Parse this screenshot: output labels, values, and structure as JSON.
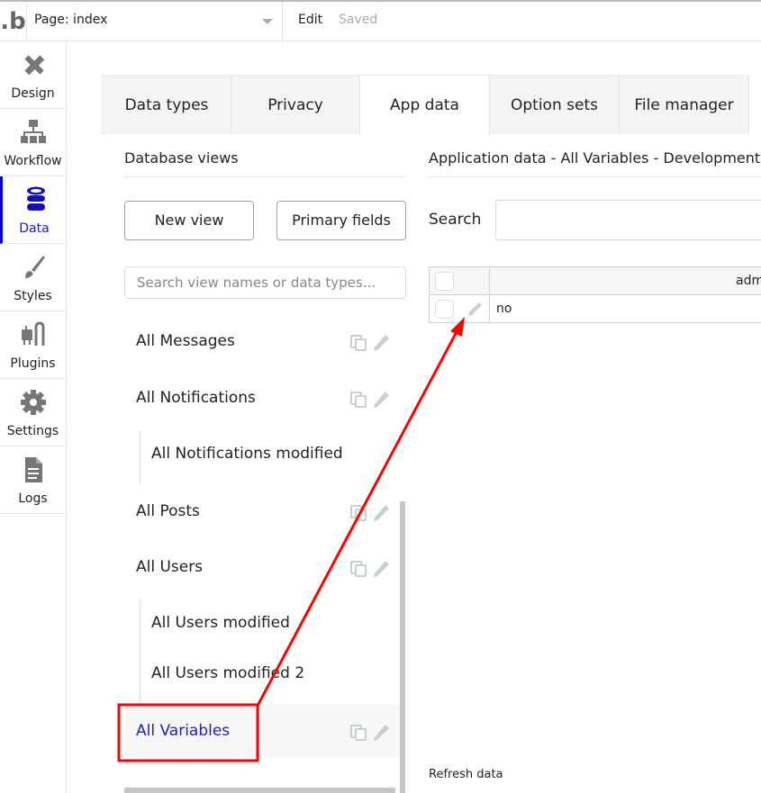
{
  "topbar": {
    "logo": ".b",
    "page_label": "Page: index",
    "edit_label": "Edit",
    "status": "Saved"
  },
  "sidenav": {
    "items": [
      {
        "label": "Design",
        "icon": "design-icon",
        "active": false
      },
      {
        "label": "Workflow",
        "icon": "workflow-icon",
        "active": false
      },
      {
        "label": "Data",
        "icon": "database-icon",
        "active": true
      },
      {
        "label": "Styles",
        "icon": "brush-icon",
        "active": false
      },
      {
        "label": "Plugins",
        "icon": "plug-icon",
        "active": false
      },
      {
        "label": "Settings",
        "icon": "gear-icon",
        "active": false
      },
      {
        "label": "Logs",
        "icon": "document-icon",
        "active": false
      }
    ]
  },
  "tabs": [
    {
      "label": "Data types",
      "active": false
    },
    {
      "label": "Privacy",
      "active": false
    },
    {
      "label": "App data",
      "active": true
    },
    {
      "label": "Option sets",
      "active": false
    },
    {
      "label": "File manager",
      "active": false
    }
  ],
  "database_views": {
    "title": "Database views",
    "new_view_label": "New view",
    "primary_fields_label": "Primary fields",
    "search_placeholder": "Search view names or data types...",
    "views": [
      {
        "name": "All Messages",
        "sub": false,
        "actions": true,
        "selected": false
      },
      {
        "name": "All Notifications",
        "sub": false,
        "actions": true,
        "selected": false
      },
      {
        "name": "All Notifications modified",
        "sub": true,
        "actions": false,
        "selected": false
      },
      {
        "name": "All Posts",
        "sub": false,
        "actions": true,
        "selected": false
      },
      {
        "name": "All Users",
        "sub": false,
        "actions": true,
        "selected": false
      },
      {
        "name": "All Users modified",
        "sub": true,
        "actions": false,
        "selected": false
      },
      {
        "name": "All Users modified 2",
        "sub": true,
        "actions": false,
        "selected": false
      },
      {
        "name": "All Variables",
        "sub": false,
        "actions": true,
        "selected": true
      }
    ]
  },
  "app_data": {
    "title": "Application data - All Variables - Development",
    "search_label": "Search",
    "search_value": "",
    "table": {
      "columns": [
        "adm"
      ],
      "rows": [
        [
          "no"
        ]
      ]
    },
    "refresh_label": "Refresh data"
  },
  "annotation": {
    "color": "#ff0000",
    "highlight_target": "All Variables",
    "arrow_target": "row-edit-pencil"
  }
}
